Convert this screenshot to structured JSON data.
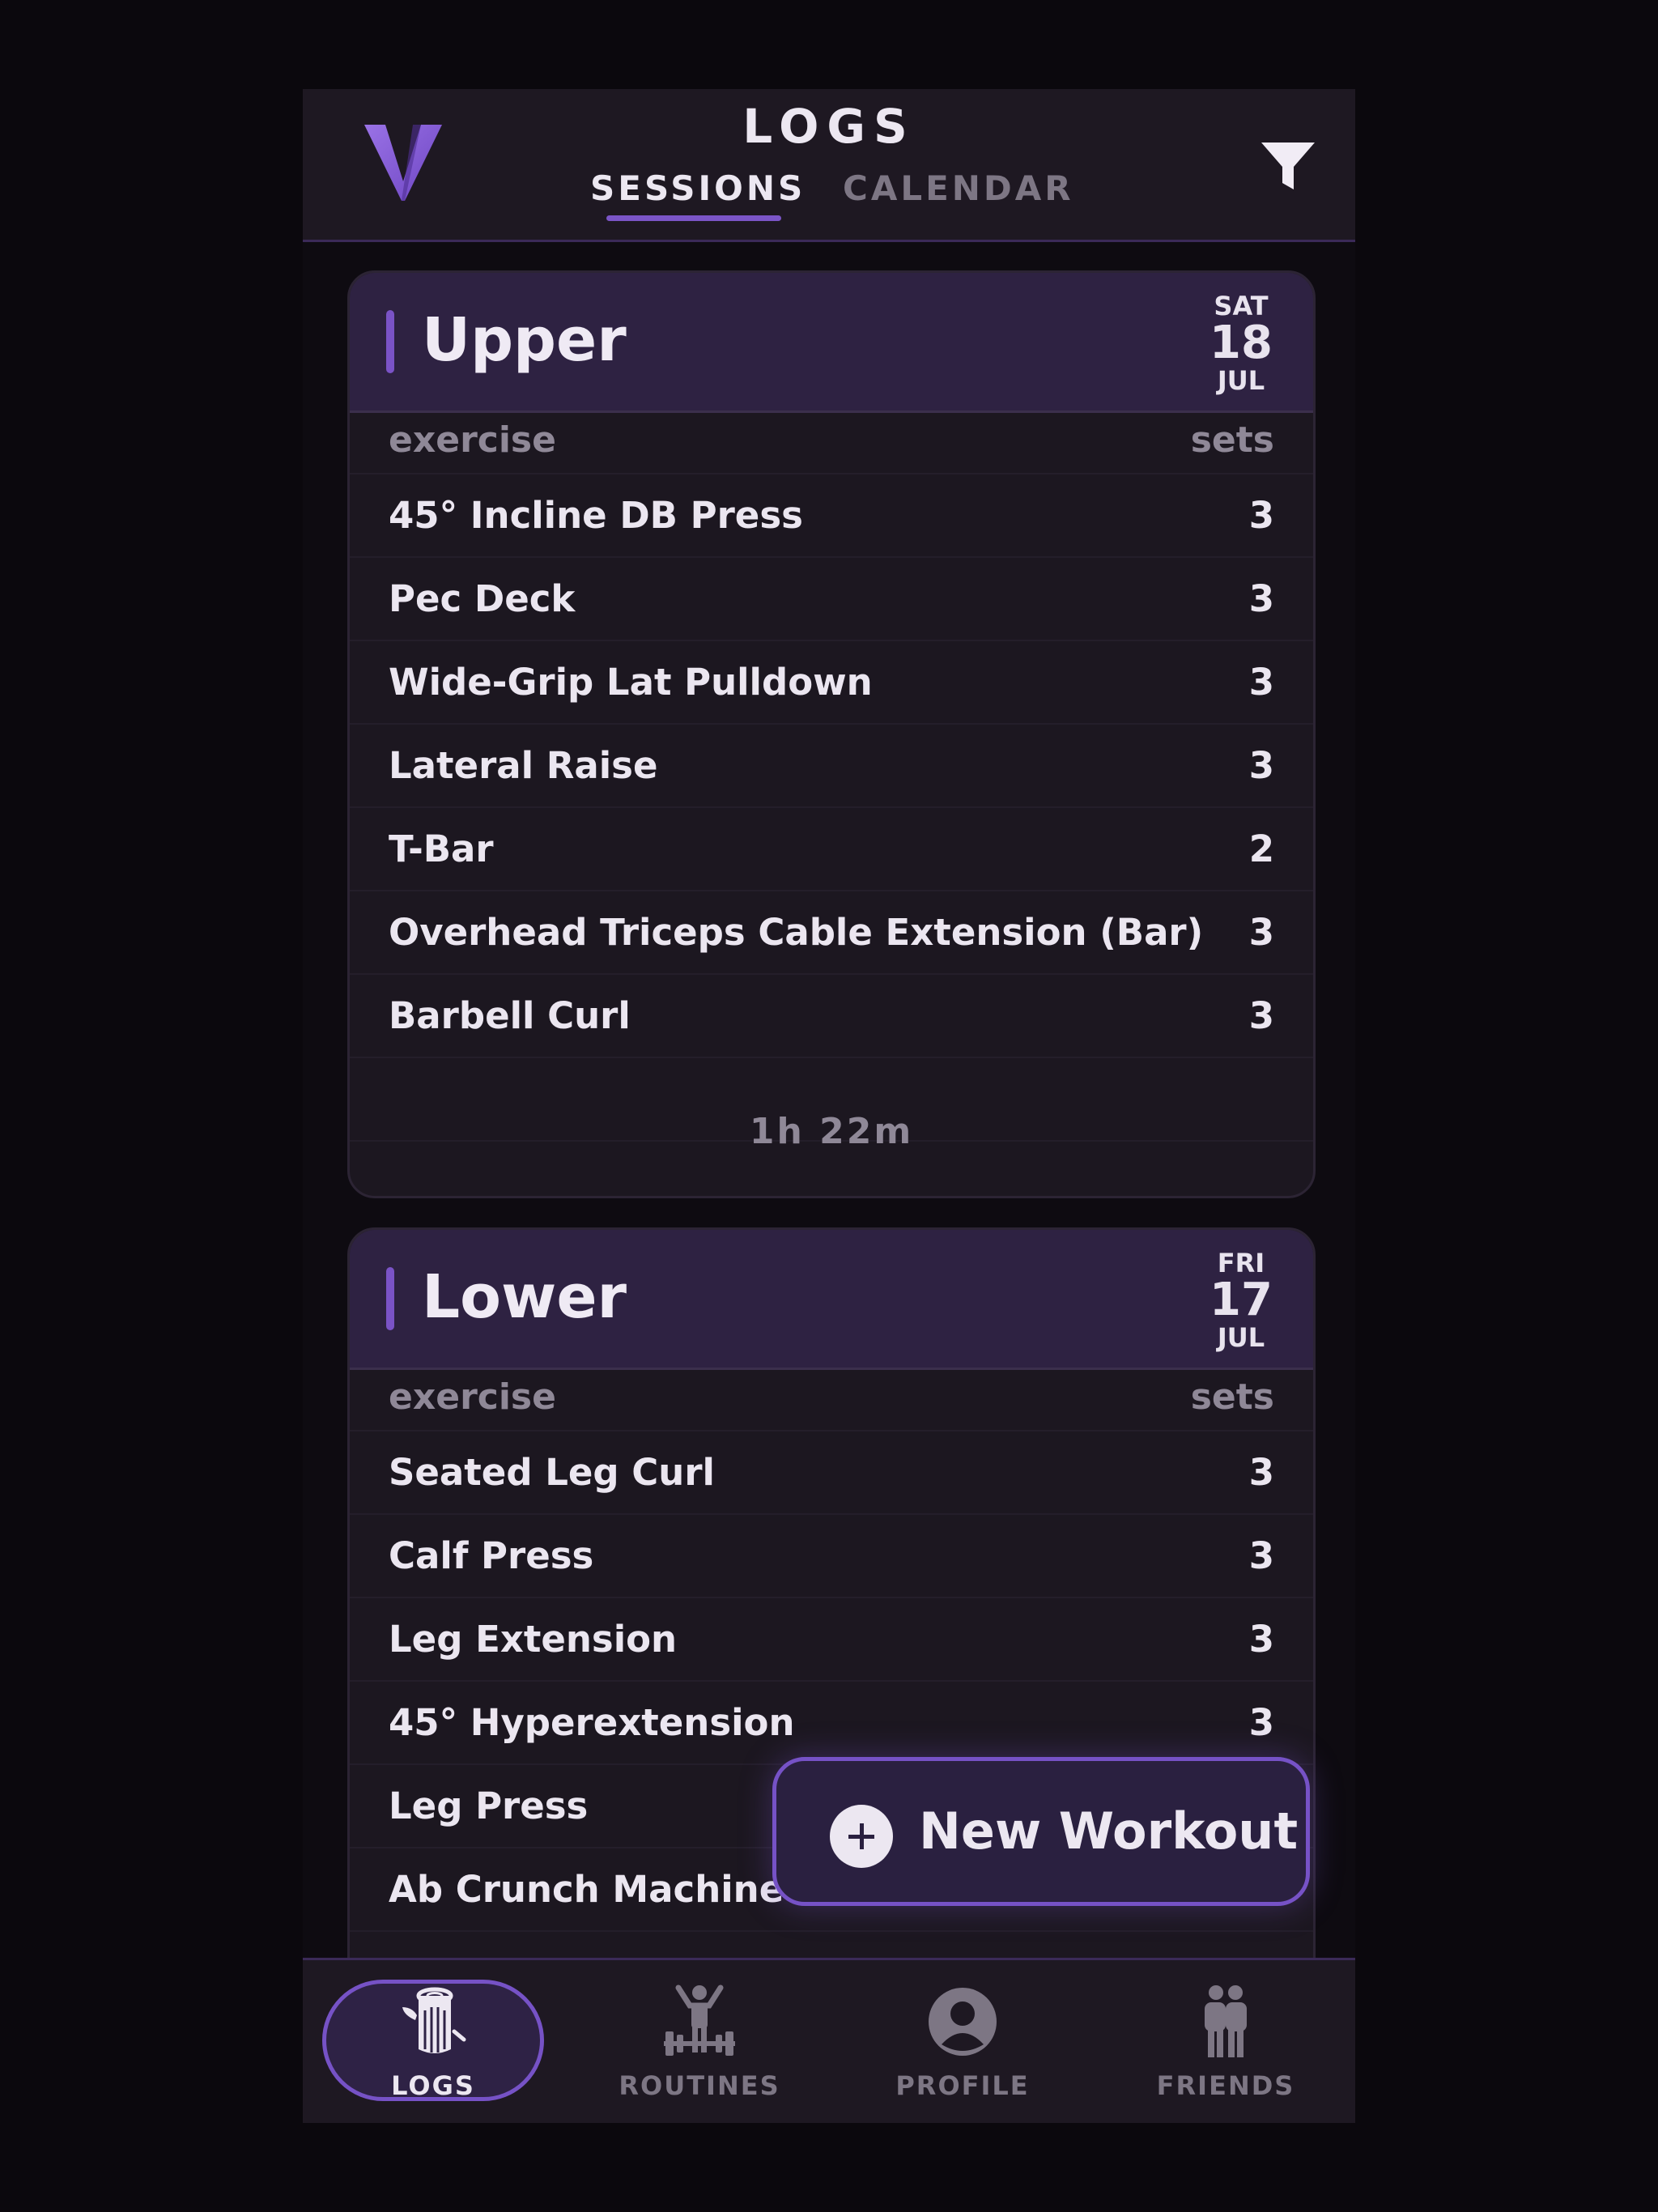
{
  "header": {
    "title": "LOGS",
    "tabs": [
      {
        "label": "SESSIONS",
        "active": true
      },
      {
        "label": "CALENDAR",
        "active": false
      }
    ],
    "logo_icon": "v-logo",
    "filter_icon": "filter-icon"
  },
  "sessions": [
    {
      "name": "Upper",
      "date": {
        "dow": "SAT",
        "day": "18",
        "month": "JUL"
      },
      "col_exercise": "exercise",
      "col_sets": "sets",
      "exercises": [
        {
          "name": "45° Incline DB Press",
          "sets": "3"
        },
        {
          "name": "Pec Deck",
          "sets": "3"
        },
        {
          "name": "Wide-Grip Lat Pulldown",
          "sets": "3"
        },
        {
          "name": "Lateral Raise",
          "sets": "3"
        },
        {
          "name": "T-Bar",
          "sets": "2"
        },
        {
          "name": "Overhead Triceps Cable Extension (Bar)",
          "sets": "3"
        },
        {
          "name": "Barbell Curl",
          "sets": "3"
        }
      ],
      "duration": "1h 22m"
    },
    {
      "name": "Lower",
      "date": {
        "dow": "FRI",
        "day": "17",
        "month": "JUL"
      },
      "col_exercise": "exercise",
      "col_sets": "sets",
      "exercises": [
        {
          "name": "Seated Leg Curl",
          "sets": "3"
        },
        {
          "name": "Calf Press",
          "sets": "3"
        },
        {
          "name": "Leg Extension",
          "sets": "3"
        },
        {
          "name": "45° Hyperextension",
          "sets": "3"
        },
        {
          "name": "Leg Press",
          "sets": ""
        },
        {
          "name": "Ab Crunch Machine",
          "sets": ""
        }
      ]
    }
  ],
  "fab": {
    "label": "New Workout",
    "icon": "plus-circle-icon"
  },
  "bottom_nav": [
    {
      "label": "LOGS",
      "icon": "log-icon",
      "active": true
    },
    {
      "label": "ROUTINES",
      "icon": "weightlifter-icon",
      "active": false
    },
    {
      "label": "PROFILE",
      "icon": "person-circle-icon",
      "active": false
    },
    {
      "label": "FRIENDS",
      "icon": "friends-icon",
      "active": false
    }
  ],
  "colors": {
    "background": "#0b080d",
    "surface": "#1e1822",
    "card_header": "#2e2242",
    "accent": "#7652c6",
    "text": "#ece7f1",
    "muted": "#8f8897"
  }
}
